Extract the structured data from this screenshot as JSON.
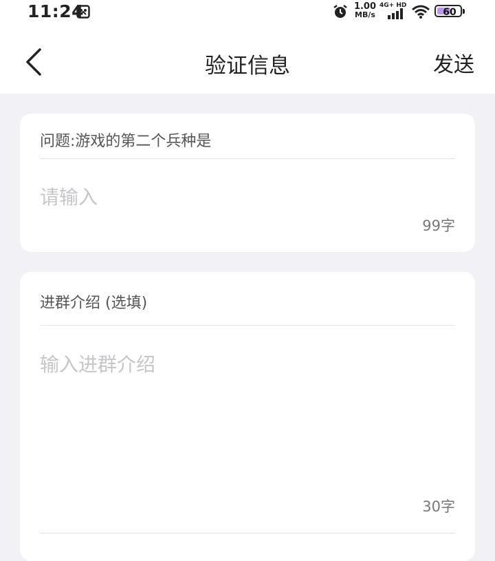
{
  "status_bar": {
    "time": "11:24",
    "speed_value": "1.00",
    "speed_unit": "MB/s",
    "network_label": "4G+ HD",
    "battery_level": "60",
    "battery_fraction": 0.6,
    "battery_fill_color": "#b69ce6"
  },
  "header": {
    "title": "验证信息",
    "send_label": "发送"
  },
  "question_card": {
    "question": "问题:游戏的第二个兵种是",
    "answer_placeholder": "请输入",
    "char_count": "99字"
  },
  "intro_card": {
    "label": "进群介绍 (选填)",
    "placeholder": "输入进群介绍",
    "char_count": "30字"
  }
}
